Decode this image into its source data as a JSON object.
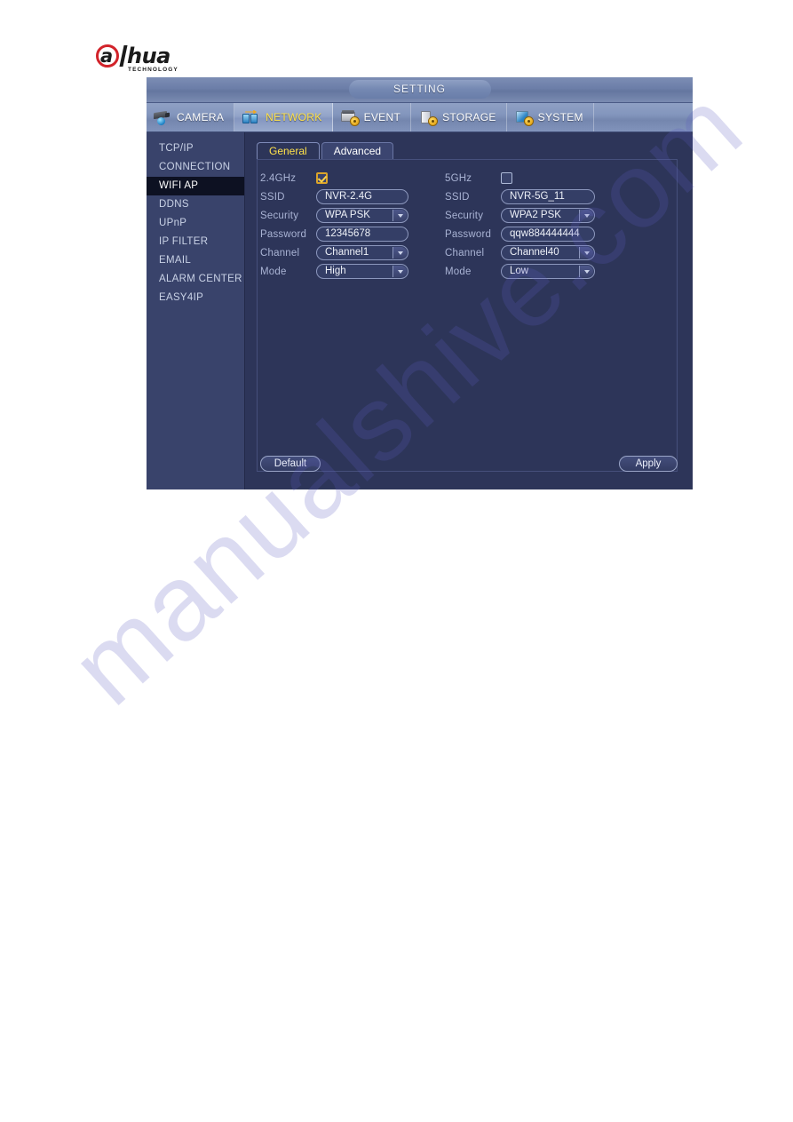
{
  "brand": {
    "logo_letter": "a",
    "logo_word": "hua",
    "logo_sub": "TECHNOLOGY"
  },
  "watermark": {
    "text": "manualshive.com"
  },
  "window": {
    "title": "SETTING"
  },
  "nav": {
    "items": [
      {
        "label": "CAMERA",
        "icon": "camera-icon",
        "active": false
      },
      {
        "label": "NETWORK",
        "icon": "network-icon",
        "active": true
      },
      {
        "label": "EVENT",
        "icon": "event-icon",
        "active": false
      },
      {
        "label": "STORAGE",
        "icon": "storage-icon",
        "active": false
      },
      {
        "label": "SYSTEM",
        "icon": "system-icon",
        "active": false
      }
    ]
  },
  "sidebar": {
    "items": [
      {
        "label": "TCP/IP",
        "active": false
      },
      {
        "label": "CONNECTION",
        "active": false
      },
      {
        "label": "WIFI AP",
        "active": true
      },
      {
        "label": "DDNS",
        "active": false
      },
      {
        "label": "UPnP",
        "active": false
      },
      {
        "label": "IP FILTER",
        "active": false
      },
      {
        "label": "EMAIL",
        "active": false
      },
      {
        "label": "ALARM CENTER",
        "active": false
      },
      {
        "label": "EASY4IP",
        "active": false
      }
    ]
  },
  "tabs": [
    {
      "label": "General",
      "active": true
    },
    {
      "label": "Advanced",
      "active": false
    }
  ],
  "form": {
    "left": {
      "band_label": "2.4GHz",
      "band_enabled": true,
      "rows": [
        {
          "label": "SSID",
          "value": "NVR-2.4G",
          "type": "text"
        },
        {
          "label": "Security",
          "value": "WPA PSK",
          "type": "select"
        },
        {
          "label": "Password",
          "value": "12345678",
          "type": "text"
        },
        {
          "label": "Channel",
          "value": "Channel1",
          "type": "select"
        },
        {
          "label": "Mode",
          "value": "High",
          "type": "select"
        }
      ]
    },
    "right": {
      "band_label": "5GHz",
      "band_enabled": false,
      "rows": [
        {
          "label": "SSID",
          "value": "NVR-5G_11",
          "type": "text"
        },
        {
          "label": "Security",
          "value": "WPA2 PSK",
          "type": "select"
        },
        {
          "label": "Password",
          "value": "qqw884444444",
          "type": "text"
        },
        {
          "label": "Channel",
          "value": "Channel40",
          "type": "select"
        },
        {
          "label": "Mode",
          "value": "Low",
          "type": "select"
        }
      ]
    }
  },
  "buttons": {
    "default_label": "Default",
    "apply_label": "Apply"
  },
  "colors": {
    "window_bg": "#2d3559",
    "sidebar_bg": "#39436b",
    "accent_yellow": "#ffe14a",
    "selected_item_bg": "#0d1122",
    "label_text": "#a9b3d4",
    "logo_red": "#d2232a"
  }
}
